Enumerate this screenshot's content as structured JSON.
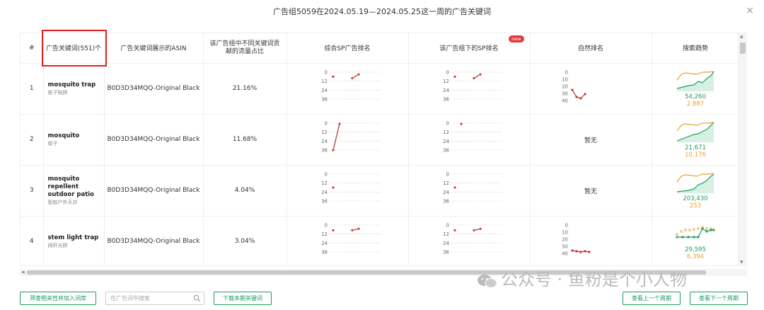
{
  "dialog": {
    "title": "广告组5059在2024.05.19—2024.05.25这一周的广告关键词",
    "close_glyph": "×"
  },
  "table": {
    "headers": {
      "index": "#",
      "keyword": "广告关键词(551)个",
      "asin": "广告关键词展示的ASIN",
      "share": "该广告组中不同关键词贡献的流量占比",
      "sp_rank": "综合SP广告排名",
      "group_sp_rank": "该广告组下的SP排名",
      "natural_rank": "自然排名",
      "trend": "搜索趋势"
    },
    "new_badge": "new",
    "rank_ticks": [
      "0",
      "12",
      "24",
      "36"
    ],
    "natural_ticks": [
      "0",
      "10",
      "20",
      "30",
      "40"
    ],
    "no_data": "暂无",
    "rows": [
      {
        "index": "1",
        "keyword": "mosquito trap",
        "keyword_cn": "蚊子陷阱",
        "asin": "B0D3D34MQQ-Original Black",
        "share": "21.16%",
        "sp": [
          [
            0,
            6
          ],
          [
            3,
            8
          ],
          [
            4,
            3
          ]
        ],
        "sp_line": [
          [
            3,
            8
          ],
          [
            4,
            3
          ]
        ],
        "gsp": [
          [
            0,
            6
          ],
          [
            3,
            8
          ],
          [
            4,
            3
          ]
        ],
        "gsp_line": [
          [
            3,
            8
          ],
          [
            4,
            3
          ]
        ],
        "natural": [
          25,
          35,
          37,
          31
        ],
        "has_natural": true,
        "trend_val1": "54,260",
        "trend_val2": "2,887"
      },
      {
        "index": "2",
        "keyword": "mosquito",
        "keyword_cn": "蚊子",
        "asin": "B0D3D34MQQ-Original Black",
        "share": "11.68%",
        "sp": [
          [
            0,
            36
          ],
          [
            1,
            1
          ]
        ],
        "sp_line": [
          [
            0,
            36
          ],
          [
            1,
            1
          ]
        ],
        "gsp": [
          [
            1,
            1
          ]
        ],
        "gsp_line": [],
        "natural": [],
        "has_natural": false,
        "trend_val1": "21,671",
        "trend_val2": "10,176"
      },
      {
        "index": "3",
        "keyword": "mosquito repellent outdoor patio",
        "keyword_cn": "驱蚊户外天井",
        "asin": "B0D3D34MQQ-Original Black",
        "share": "4.04%",
        "sp": [
          [
            0,
            18
          ]
        ],
        "sp_line": [],
        "gsp": [
          [
            0,
            18
          ]
        ],
        "gsp_line": [],
        "natural": [],
        "has_natural": false,
        "trend_val1": "203,430",
        "trend_val2": "253"
      },
      {
        "index": "4",
        "keyword": "stem light trap",
        "keyword_cn": "阀杆光阱",
        "asin": "B0D3D34MQQ-Original Black",
        "share": "3.04%",
        "sp": [
          [
            0,
            7
          ],
          [
            3,
            7
          ],
          [
            4,
            5
          ]
        ],
        "sp_line": [
          [
            3,
            7
          ],
          [
            4,
            5
          ]
        ],
        "gsp": [
          [
            0,
            7
          ],
          [
            3,
            7
          ],
          [
            4,
            5
          ]
        ],
        "gsp_line": [
          [
            3,
            7
          ],
          [
            4,
            5
          ]
        ],
        "natural": [
          36,
          37,
          38,
          37,
          38
        ],
        "has_natural": true,
        "trend_val1": "29,595",
        "trend_val2": "6,394"
      }
    ]
  },
  "footer": {
    "filter_button": "筛查相关性并加入词库",
    "search_placeholder": "在广告词中搜索",
    "download_button": "下载本期关键词",
    "prev_button": "查看上一个周期",
    "next_button": "查看下一个周期"
  },
  "watermark": "公众号 · 鱼粉是个小人物",
  "colors": {
    "accent": "#1a9e5c",
    "rank_line": "#b03030",
    "trend_orange": "#f0a030",
    "highlight": "#e02020"
  }
}
